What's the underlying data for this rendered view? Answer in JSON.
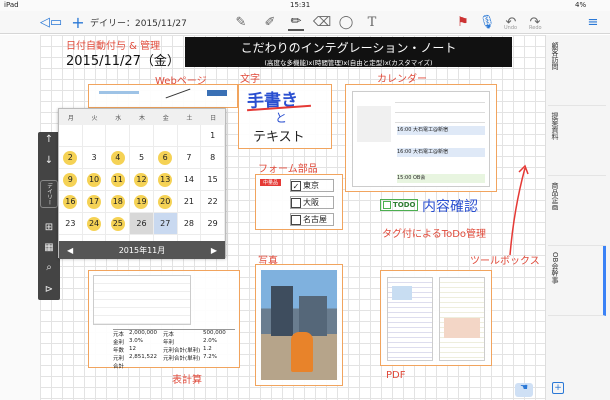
{
  "status": {
    "left": "iPad",
    "time": "15:31",
    "battery": "4%"
  },
  "toolbar": {
    "date_title": "デイリー：2015/11/27",
    "undo": "Undo",
    "redo": "Redo"
  },
  "header": {
    "section_title": "日付自動付与 & 管理",
    "date": "2015/11/27（金）",
    "banner_title": "こだわりのインテグレーション・ノート",
    "banner_sub": "(高度な多機能)x(時間管理)x(自由と定型)x(カスタマイズ)"
  },
  "labels": {
    "webpage": "Webページ",
    "text": "文字",
    "calendar": "カレンダー",
    "form": "フォーム部品",
    "photo": "写真",
    "toolbox": "ツールボックス",
    "spreadsheet": "表計算",
    "pdf": "PDF"
  },
  "handwriting": {
    "line1": "手書き",
    "line2": "と",
    "line3": "テキスト",
    "todo_hand": "内容確認"
  },
  "form": {
    "tag": "中量品",
    "options": [
      {
        "label": "東京",
        "checked": true
      },
      {
        "label": "大阪",
        "checked": false
      },
      {
        "label": "名古屋",
        "checked": false
      }
    ]
  },
  "todo": {
    "tag": "TODO",
    "caption": "タグ付によるToDo管理"
  },
  "mini_calendar": {
    "weekdays": [
      "月",
      "火",
      "水",
      "木",
      "金",
      "土",
      "日"
    ],
    "days": [
      {
        "d": "",
        "mark": ""
      },
      {
        "d": "",
        "mark": ""
      },
      {
        "d": "",
        "mark": ""
      },
      {
        "d": "",
        "mark": ""
      },
      {
        "d": "",
        "mark": ""
      },
      {
        "d": "",
        "mark": ""
      },
      {
        "d": "1",
        "mark": ""
      },
      {
        "d": "2",
        "mark": "dot"
      },
      {
        "d": "3",
        "mark": ""
      },
      {
        "d": "4",
        "mark": "dot"
      },
      {
        "d": "5",
        "mark": ""
      },
      {
        "d": "6",
        "mark": "dot"
      },
      {
        "d": "7",
        "mark": ""
      },
      {
        "d": "8",
        "mark": ""
      },
      {
        "d": "9",
        "mark": "dot"
      },
      {
        "d": "10",
        "mark": "dot"
      },
      {
        "d": "11",
        "mark": "dot"
      },
      {
        "d": "12",
        "mark": "dot"
      },
      {
        "d": "13",
        "mark": "dot"
      },
      {
        "d": "14",
        "mark": ""
      },
      {
        "d": "15",
        "mark": ""
      },
      {
        "d": "16",
        "mark": "dot"
      },
      {
        "d": "17",
        "mark": "dot"
      },
      {
        "d": "18",
        "mark": "dot"
      },
      {
        "d": "19",
        "mark": "dot"
      },
      {
        "d": "20",
        "mark": "dot"
      },
      {
        "d": "21",
        "mark": ""
      },
      {
        "d": "22",
        "mark": ""
      },
      {
        "d": "23",
        "mark": ""
      },
      {
        "d": "24",
        "mark": "dot"
      },
      {
        "d": "25",
        "mark": "dot"
      },
      {
        "d": "26",
        "mark": "gray"
      },
      {
        "d": "27",
        "mark": "sel"
      },
      {
        "d": "28",
        "mark": ""
      },
      {
        "d": "29",
        "mark": ""
      },
      {
        "d": "30",
        "mark": ""
      },
      {
        "d": "1",
        "mark": ""
      },
      {
        "d": "2",
        "mark": ""
      },
      {
        "d": "3",
        "mark": ""
      },
      {
        "d": "4",
        "mark": ""
      },
      {
        "d": "5",
        "mark": ""
      },
      {
        "d": "6",
        "mark": ""
      }
    ],
    "month_label": "2015年11月"
  },
  "side": {
    "daily": "デイリー"
  },
  "right_tabs": [
    {
      "label": "顧客訪問"
    },
    {
      "label": "提案資料"
    },
    {
      "label": "商品企画"
    },
    {
      "label": "OB会幹事"
    }
  ],
  "calendar_thumb": {
    "events": [
      "16:00 大石電工@新宿",
      "16:00 大石電工@新宿",
      "15:00 OB会"
    ]
  },
  "spreadsheet": {
    "rows": [
      [
        "元本",
        "2,000,000",
        "元本",
        "500,000"
      ],
      [
        "金利",
        "3.0%",
        "年利",
        "2.0%"
      ],
      [
        "年数",
        "12",
        "元利合計(単利)",
        "1.2"
      ],
      [
        "元利合計",
        "2,851,522",
        "元利合計(単利)",
        "7.2%"
      ]
    ]
  }
}
